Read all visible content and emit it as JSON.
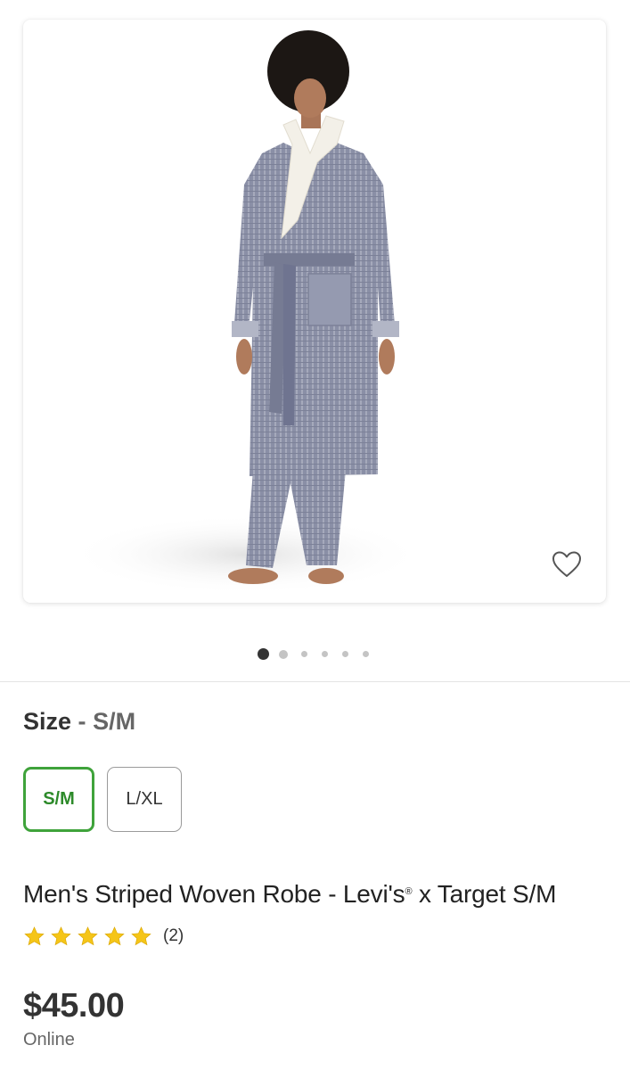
{
  "product_image": {
    "alt": "Men's Striped Woven Robe",
    "favorite_icon": "heart-outline-icon"
  },
  "carousel": {
    "total_images": 6,
    "active_index": 0
  },
  "size_selector": {
    "label": "Size",
    "separator": "-",
    "selected_value": "S/M",
    "options": [
      {
        "label": "S/M",
        "selected": true
      },
      {
        "label": "L/XL",
        "selected": false
      }
    ]
  },
  "product": {
    "title_part1": "Men's Striped Woven Robe - Levi's",
    "registered_mark": "®",
    "title_part2": " x Target S/M",
    "rating": {
      "stars": 5,
      "max_stars": 5,
      "review_count": "(2)"
    },
    "price": "$45.00",
    "availability": "Online"
  },
  "colors": {
    "accent_green": "#3fa33b",
    "star_gold": "#f5c518",
    "text_dark": "#333333",
    "text_muted": "#666666"
  }
}
